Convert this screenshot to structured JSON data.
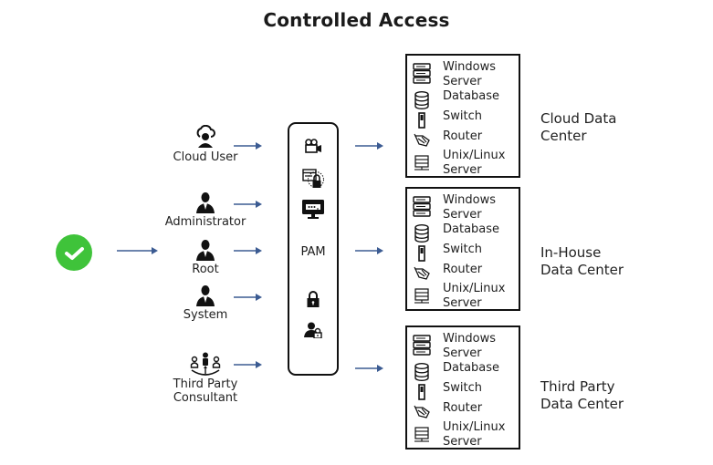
{
  "title": "Controlled Access",
  "colors": {
    "check_green": "#3fc33a",
    "arrow_blue": "#3b5b92",
    "border": "#111111"
  },
  "start": {
    "icon": "check-circle-icon"
  },
  "actors": [
    {
      "label": "Cloud User",
      "icon": "cloud-user-icon"
    },
    {
      "label": "Administrator",
      "icon": "user-suit-icon"
    },
    {
      "label": "Root",
      "icon": "user-suit-icon"
    },
    {
      "label": "System",
      "icon": "user-suit-icon"
    },
    {
      "label": "Third Party\nConsultant",
      "icon": "team-consultant-icon"
    }
  ],
  "pam": {
    "label": "PAM",
    "icons": [
      "video-camera-icon",
      "secure-browser-lock-icon",
      "monitor-password-icon",
      "padlock-icon",
      "user-lock-icon"
    ]
  },
  "data_centers": [
    {
      "name": "Cloud Data\nCenter",
      "items": [
        {
          "label": "Windows\nServer",
          "icon": "server-rack-icon"
        },
        {
          "label": "Database",
          "icon": "database-icon"
        },
        {
          "label": "Switch",
          "icon": "switch-icon"
        },
        {
          "label": "Router",
          "icon": "router-icon"
        },
        {
          "label": "Unix/Linux\nServer",
          "icon": "linux-server-icon"
        }
      ]
    },
    {
      "name": "In-House\nData Center",
      "items": [
        {
          "label": "Windows\nServer",
          "icon": "server-rack-icon"
        },
        {
          "label": "Database",
          "icon": "database-icon"
        },
        {
          "label": "Switch",
          "icon": "switch-icon"
        },
        {
          "label": "Router",
          "icon": "router-icon"
        },
        {
          "label": "Unix/Linux\nServer",
          "icon": "linux-server-icon"
        }
      ]
    },
    {
      "name": "Third Party\nData Center",
      "items": [
        {
          "label": "Windows\nServer",
          "icon": "server-rack-icon"
        },
        {
          "label": "Database",
          "icon": "database-icon"
        },
        {
          "label": "Switch",
          "icon": "switch-icon"
        },
        {
          "label": "Router",
          "icon": "router-icon"
        },
        {
          "label": "Unix/Linux\nServer",
          "icon": "linux-server-icon"
        }
      ]
    }
  ]
}
